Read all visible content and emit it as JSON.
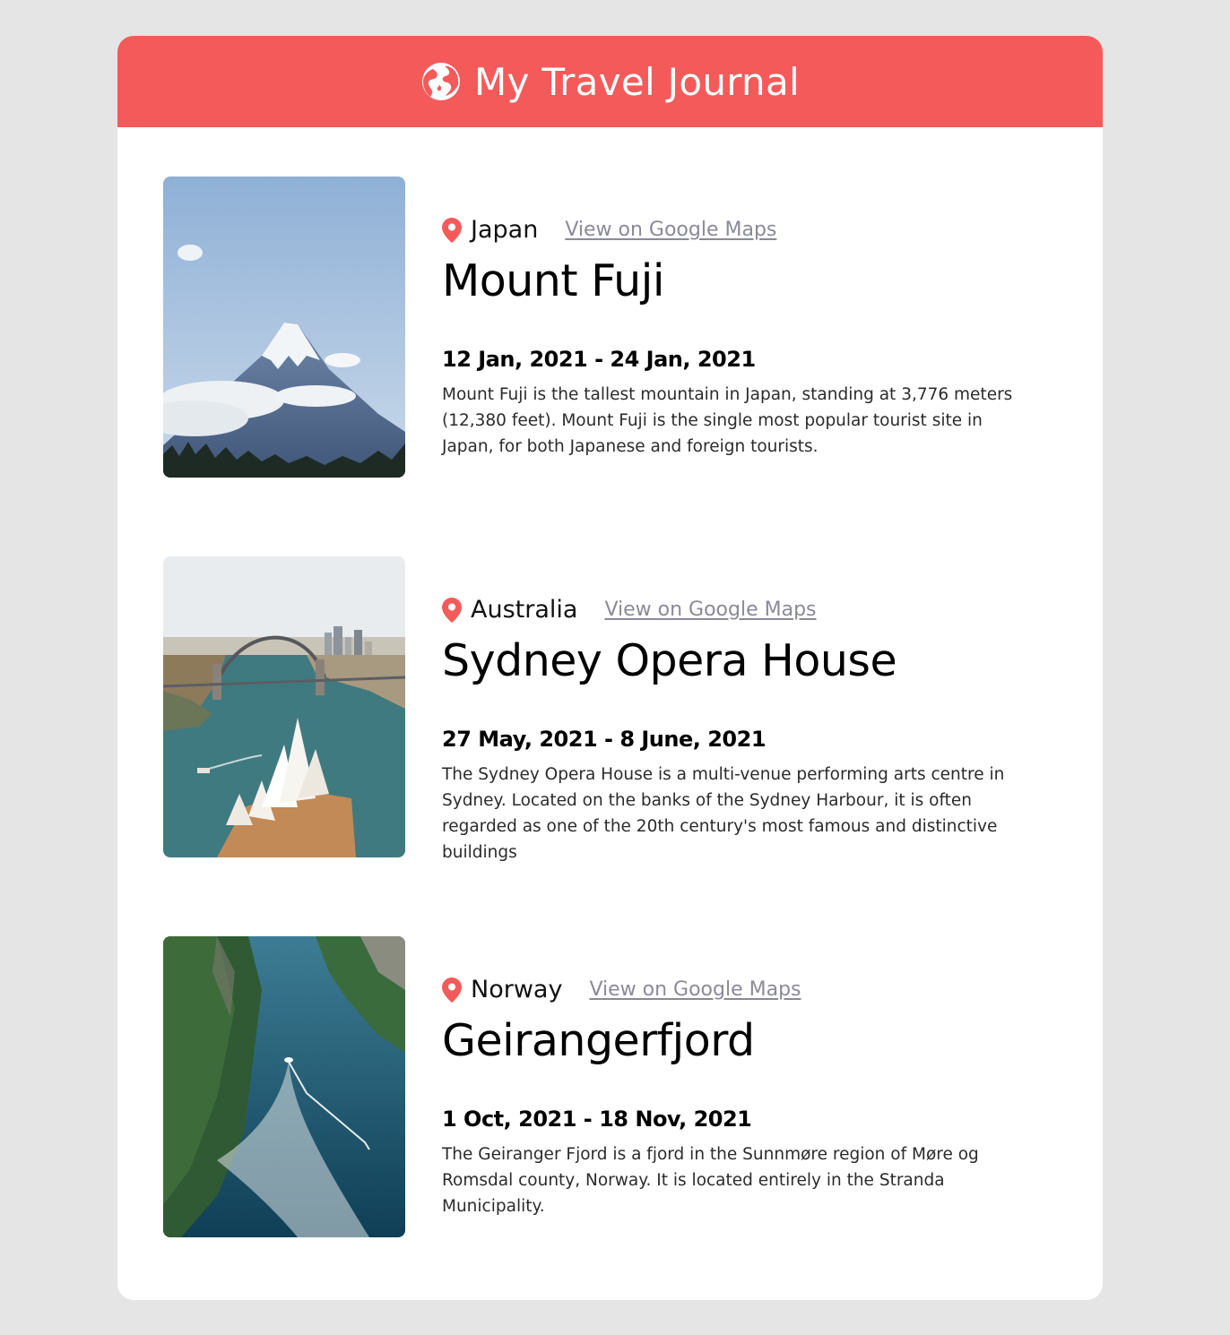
{
  "header": {
    "title": "My Travel Journal",
    "icon": "globe-icon"
  },
  "entries": [
    {
      "country": "Japan",
      "map_link": "View on Google Maps",
      "title": "Mount Fuji",
      "dates": "12 Jan, 2021 - 24 Jan, 2021",
      "description": "Mount Fuji is the tallest mountain in Japan, standing at 3,776 meters (12,380 feet). Mount Fuji is the single most popular tourist site in Japan, for both Japanese and foreign tourists."
    },
    {
      "country": "Australia",
      "map_link": "View on Google Maps",
      "title": "Sydney Opera House",
      "dates": "27 May, 2021 - 8 June, 2021",
      "description": "The Sydney Opera House is a multi-venue performing arts centre in Sydney. Located on the banks of the Sydney Harbour, it is often regarded as one of the 20th century's most famous and distinctive buildings"
    },
    {
      "country": "Norway",
      "map_link": "View on Google Maps",
      "title": "Geirangerfjord",
      "dates": "1 Oct, 2021 - 18 Nov, 2021",
      "description": "The Geiranger Fjord is a fjord in the Sunnmøre region of Møre og Romsdal county, Norway. It is located entirely in the Stranda Municipality."
    }
  ],
  "colors": {
    "accent": "#f55a5a",
    "background": "#e5e5e5",
    "link": "#8a8a98"
  }
}
